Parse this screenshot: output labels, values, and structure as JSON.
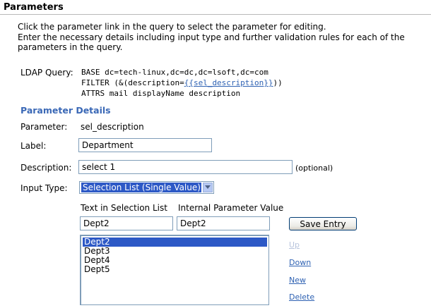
{
  "page": {
    "title": "Parameters",
    "intro_line1": "Click the parameter link in the query to select the parameter for editing.",
    "intro_line2": "Enter the necessary details including input type and further validation rules for each of the parameters in the query."
  },
  "ldap": {
    "label": "LDAP Query:",
    "base": "BASE dc=tech-linux,dc=dc,dc=lsoft,dc=com",
    "filter_prefix": "FILTER (&(description=",
    "filter_token": "{{sel_description}}",
    "filter_suffix": "))",
    "attrs": "ATTRS mail displayName description"
  },
  "details": {
    "heading": "Parameter Details",
    "parameter_label": "Parameter:",
    "parameter_value": "sel_description",
    "label_label": "Label:",
    "label_value": "Department",
    "description_label": "Description:",
    "description_value": "select 1",
    "optional_note": "(optional)",
    "input_type_label": "Input Type:",
    "input_type_value": "Selection List (Single Value)"
  },
  "selection": {
    "text_header": "Text in Selection List",
    "value_header": "Internal Parameter Value",
    "text_value": "Dept2",
    "internal_value": "Dept2",
    "save_label": "Save Entry",
    "items": [
      {
        "label": "Dept2",
        "selected": true
      },
      {
        "label": "Dept3",
        "selected": false
      },
      {
        "label": "Dept4",
        "selected": false
      },
      {
        "label": "Dept5",
        "selected": false
      }
    ],
    "actions": {
      "up": "Up",
      "down": "Down",
      "new": "New",
      "delete": "Delete"
    }
  },
  "colors": {
    "link": "#2f62b3",
    "heading": "#3a68b6",
    "selection_highlight": "#2d59c6",
    "disabled_link": "#b8c4dd"
  }
}
